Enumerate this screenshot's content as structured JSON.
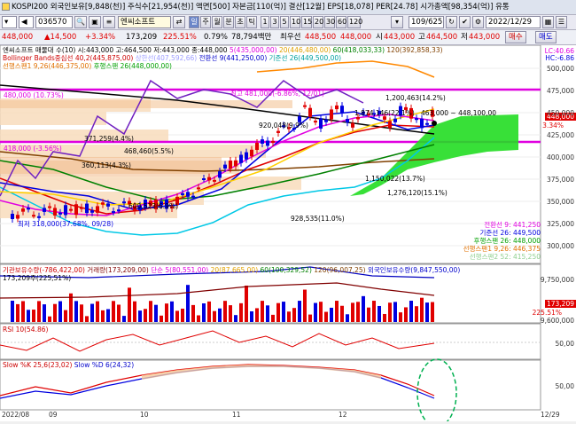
{
  "infobar": {
    "title": "KOSPI200",
    "text": "외국인보유[9,848(천)] 주식수[21,954(천)] 액면[500] 자본금[110(억)] 결산[12월] EPS[18,078] PER[24.78] 시가총액[98,354(억)] 유통"
  },
  "toolbar": {
    "code": "036570",
    "name": "엔씨소프트",
    "tabs": [
      "일",
      "주",
      "월",
      "분",
      "초",
      "틱"
    ],
    "selected_tab": "일",
    "intervals": [
      "1",
      "3",
      "5",
      "10",
      "15",
      "20",
      "30",
      "60",
      "120"
    ],
    "count": "109/625",
    "date": "2022/12/29"
  },
  "pricebar": {
    "price": "448,000",
    "change": "14,500",
    "change_pct": "+3.34%",
    "volume": "173,209",
    "vol_ratio": "225.51%",
    "turnover": "0.79%",
    "amount": "78,794백만",
    "best_ask_label": "최우선",
    "best_ask": "448,500",
    "best_bid": "448,000",
    "low_label": "시",
    "open": "443,000",
    "high_label": "고",
    "high": "464,500",
    "low2_label": "저",
    "low": "443,000",
    "buy_button": "매수",
    "sell_button": "매도"
  },
  "price_panel": {
    "legend1": "엔씨소프트 매물대 수(10) 시:443,000 고:464,500 저:443,000 종:448,000",
    "ma5": "5(435,000,00)",
    "ma20": "20(446,480,00)",
    "ma60": "60(418,033,33)",
    "ma120": "120(392,858,33)",
    "legend2": "Bollinger Bands중심선 40,2(445,875,00)",
    "legend3": "상한선(407,592,66)",
    "legend4": "전환선 9(441,250,00)",
    "legend5": "기준선 26(449,500,00)",
    "legend6": "선행스팬1 9,26(446,375,00)",
    "legend7": "후행스팬 26(448,000,00)",
    "lc": "LC:40.66",
    "hc": "HC:-6.86",
    "high_mark": "최고 481,000(-6.86%, 12/01)",
    "low_mark": "최저 318,000(37.68%, 09/28)",
    "level_480": "480,000 (10.73%)",
    "level_418": "418,000 (-3.56%)",
    "vp_labels": [
      "1,200,463(14.2%)",
      "1,874,146(22.1%)",
      "1,150,022(13.7%)",
      "1,276,120(15.1%)",
      "928,535(11.0%)",
      "371,259(4.4%)",
      "468,460(5.5%)",
      "360,113(4.3%)",
      "920,048(9.9%)",
      "600,523(6.9%)"
    ],
    "range_note": "463,000 ~ 448,100,00",
    "current_price_tag": "448,000",
    "current_pct_tag": "3.34%",
    "y_ticks": [
      "500,000",
      "475,000",
      "450,000",
      "425,000",
      "400,000",
      "375,000",
      "350,000",
      "325,000",
      "300,000"
    ],
    "right_legend": [
      "전환선 9: 441,250",
      "기준선 26: 449,500",
      "후행스팬 26: 448,000",
      "선행스팬1 9,26: 446,375",
      "선행스팬2 52: 415,250"
    ]
  },
  "volume_panel": {
    "legend": "기관보유수량(-786,422,00)",
    "legend_vol": "거래량(173,209,00)",
    "legend_ma5": "단순 5(80,551,00)",
    "legend_ma20": "20(87,665,00)",
    "legend_ma60": "60(100,329,52)",
    "legend_ma120": "120(96,007,25)",
    "legend_foreign": "외국인보유수량(9,847,550,00)",
    "sub": "173,209주(225,51%)",
    "tag1": "173,209",
    "tag2": "225.51%",
    "y_ticks": [
      "9,750,000",
      "9,600,000"
    ]
  },
  "rsi_panel": {
    "legend": "RSI 10(54.86)",
    "y_ticks": [
      "50,00"
    ]
  },
  "stoch_panel": {
    "legend_k": "Slow %K 25,6(23,02)",
    "legend_d": "Slow %D 6(24,32)",
    "y_ticks": [
      "50,00"
    ]
  },
  "x_axis": [
    "2022/08",
    "09",
    "10",
    "11",
    "12",
    "12/29"
  ],
  "colors": {
    "up": "#e00000",
    "down": "#0000e0",
    "magenta": "#e000e0",
    "cloud": "#00e000",
    "vp": "#f5c99a"
  }
}
